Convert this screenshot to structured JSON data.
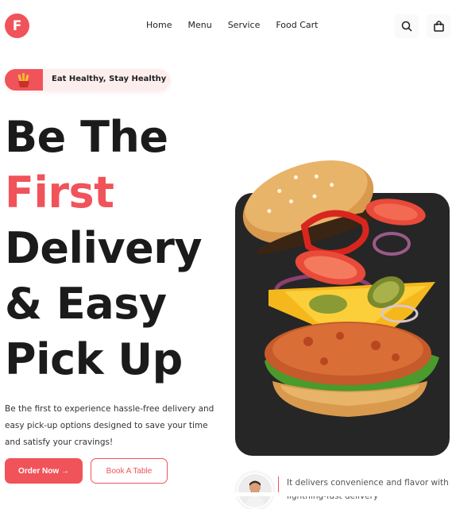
{
  "brand": {
    "logo_letter": "F"
  },
  "nav": {
    "items": [
      "Home",
      "Menu",
      "Service",
      "Food Cart"
    ]
  },
  "header_icons": [
    "search-icon",
    "shopping-bag-icon"
  ],
  "badge": {
    "text": "Eat Healthy, Stay Healthy"
  },
  "hero": {
    "line1": "Be The",
    "line2": "First",
    "line3": "Delivery",
    "line4": "& Easy",
    "line5": "Pick Up",
    "description": "Be the first to experience hassle-free delivery and easy pick-up options designed to save your time and satisfy your cravings!"
  },
  "buttons": {
    "order": "Order Now →",
    "book": "Book A Table"
  },
  "info": {
    "text": "It delivers convenience and flavor with lightning-fast delivery"
  },
  "colors": {
    "accent": "#f0535a",
    "dark": "#262626"
  }
}
